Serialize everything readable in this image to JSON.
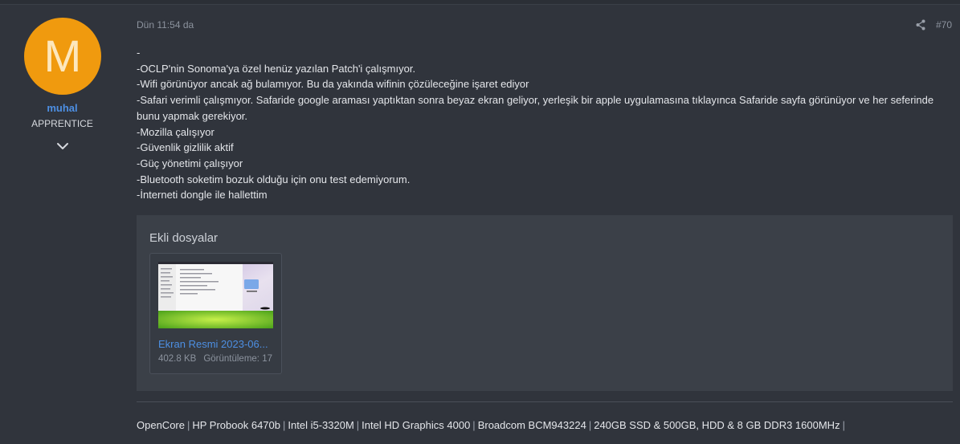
{
  "user": {
    "avatar_letter": "M",
    "avatar_color": "#f09a0e",
    "name": "muhal",
    "name_color": "#4d8fe3",
    "title": "APPRENTICE",
    "expand_icon": "chevron-down-icon"
  },
  "post": {
    "date": "Dün 11:54 da",
    "share_icon": "share-icon",
    "number": "#70",
    "lines": [
      "-",
      "-OCLP'nin Sonoma'ya özel henüz yazılan Patch'i çalışmıyor.",
      "-Wifi görünüyor ancak ağ bulamıyor. Bu da yakında wifinin çözüleceğine işaret ediyor",
      "-Safari verimli çalışmıyor. Safaride google araması yaptıktan sonra beyaz ekran geliyor, yerleşik bir apple uygulamasına tıklayınca Safaride sayfa görünüyor ve her seferinde bunu yapmak gerekiyor.",
      "-Mozilla çalışıyor",
      "-Güvenlik gizlilik aktif",
      "-Güç yönetimi çalışıyor",
      "-Bluetooth soketim bozuk olduğu için onu test edemiyorum.",
      "-İnterneti dongle ile hallettim"
    ]
  },
  "attachments": {
    "title": "Ekli dosyalar",
    "files": [
      {
        "name": "Ekran Resmi 2023-06...",
        "size": "402.8 KB",
        "views": "Görüntüleme: 17"
      }
    ]
  },
  "signature": {
    "items": [
      "OpenCore",
      "HP Probook 6470b",
      "Intel i5-3320M",
      "Intel HD Graphics 4000",
      "Broadcom BCM943224",
      "240GB SSD & 500GB, HDD & 8 GB DDR3 1600MHz"
    ],
    "separator": "|"
  }
}
